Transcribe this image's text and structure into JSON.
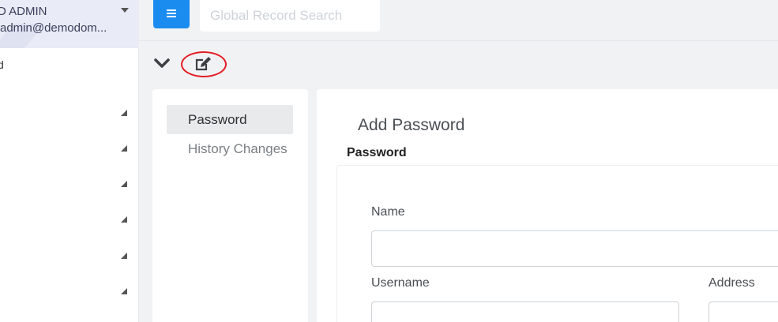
{
  "user": {
    "name": "D ADMIN",
    "email": "admin@demodom..."
  },
  "sidebar": {
    "partial_label": "d"
  },
  "search": {
    "placeholder": "Global Record Search"
  },
  "tabs": [
    {
      "label": "Password",
      "active": true
    },
    {
      "label": "History Changes",
      "active": false
    }
  ],
  "form": {
    "title": "Add Password",
    "section": "Password",
    "fields": {
      "name_label": "Name",
      "username_label": "Username",
      "address_label": "Address",
      "name_value": "",
      "username_value": "",
      "address_value": ""
    }
  },
  "colors": {
    "accent": "#1a8cf0",
    "highlight": "#e21d24"
  },
  "icons": [
    "menu-icon",
    "chevron-down-icon",
    "edit-icon",
    "caret-down-icon",
    "expand-arrow-icon"
  ]
}
